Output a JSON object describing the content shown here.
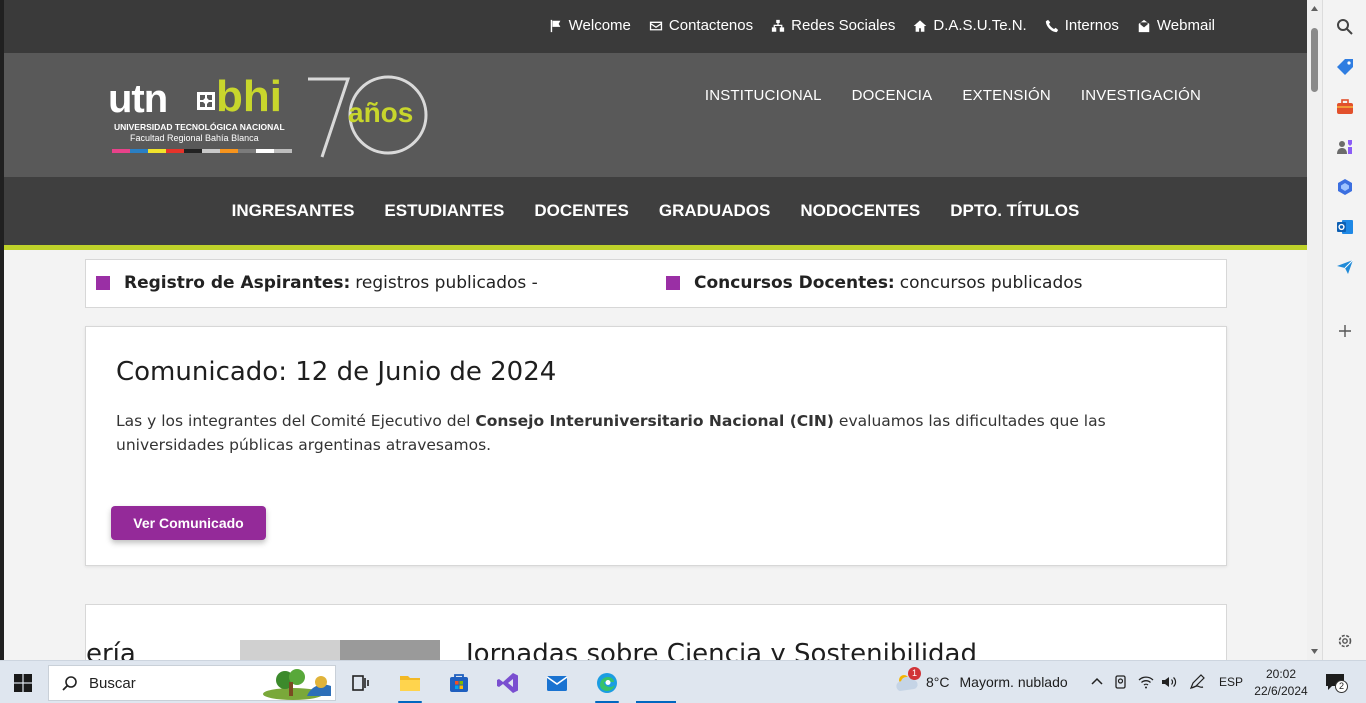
{
  "topbar": {
    "links": [
      {
        "label": "Welcome",
        "icon": "flag-icon"
      },
      {
        "label": "Contactenos",
        "icon": "envelope-icon"
      },
      {
        "label": "Redes Sociales",
        "icon": "sitemap-icon"
      },
      {
        "label": "D.A.S.U.Te.N.",
        "icon": "home-icon"
      },
      {
        "label": "Internos",
        "icon": "phone-icon"
      },
      {
        "label": "Webmail",
        "icon": "mail-open-icon"
      }
    ]
  },
  "logo": {
    "utn": "utn",
    "bhi": "bhi",
    "line1": "UNIVERSIDAD TECNOLÓGICA NACIONAL",
    "line2": "Facultad Regional Bahía Blanca",
    "seventy": "70",
    "anos": "años",
    "colors": [
      "#e8428a",
      "#2a7fc4",
      "#f1e32b",
      "#e6332a",
      "#222222",
      "#c9c9c9",
      "#f7941d",
      "#7b7b7b",
      "#ffffff",
      "#bdbdbd"
    ],
    "accent": "#c8d62c"
  },
  "mainnav": [
    "INSTITUCIONAL",
    "DOCENCIA",
    "EXTENSIÓN",
    "INVESTIGACIÓN"
  ],
  "audnav": [
    "INGRESANTES",
    "ESTUDIANTES",
    "DOCENTES",
    "GRADUADOS",
    "NODOCENTES",
    "DPTO. TÍTULOS"
  ],
  "ticker": [
    {
      "title": "Registro de Aspirantes:",
      "text": "registros publicados -"
    },
    {
      "title": "Concursos Docentes:",
      "text": "concursos publicados"
    }
  ],
  "card": {
    "title": "Comunicado: 12 de Junio de 2024",
    "text_before": "Las y los integrantes del Comité Ejecutivo del ",
    "text_bold": "Consejo Interuniversitario Nacional (CIN)",
    "text_after": " evaluamos las dificultades que las universidades públicas argentinas atravesamos.",
    "button": "Ver Comunicado"
  },
  "card2": {
    "fragment": "ería",
    "title": "Jornadas sobre Ciencia y Sostenibilidad"
  },
  "taskbar": {
    "search_label": "Buscar",
    "weather_temp": "8°C",
    "weather_text": "Mayorm. nublado",
    "weather_badge": "1",
    "lang": "ESP",
    "time": "20:02",
    "date": "22/6/2024",
    "notif_count": "2"
  },
  "colors": {
    "purple": "#942a99",
    "lime": "#bfd22a",
    "dark": "#3f3f3f",
    "header": "#595959"
  }
}
